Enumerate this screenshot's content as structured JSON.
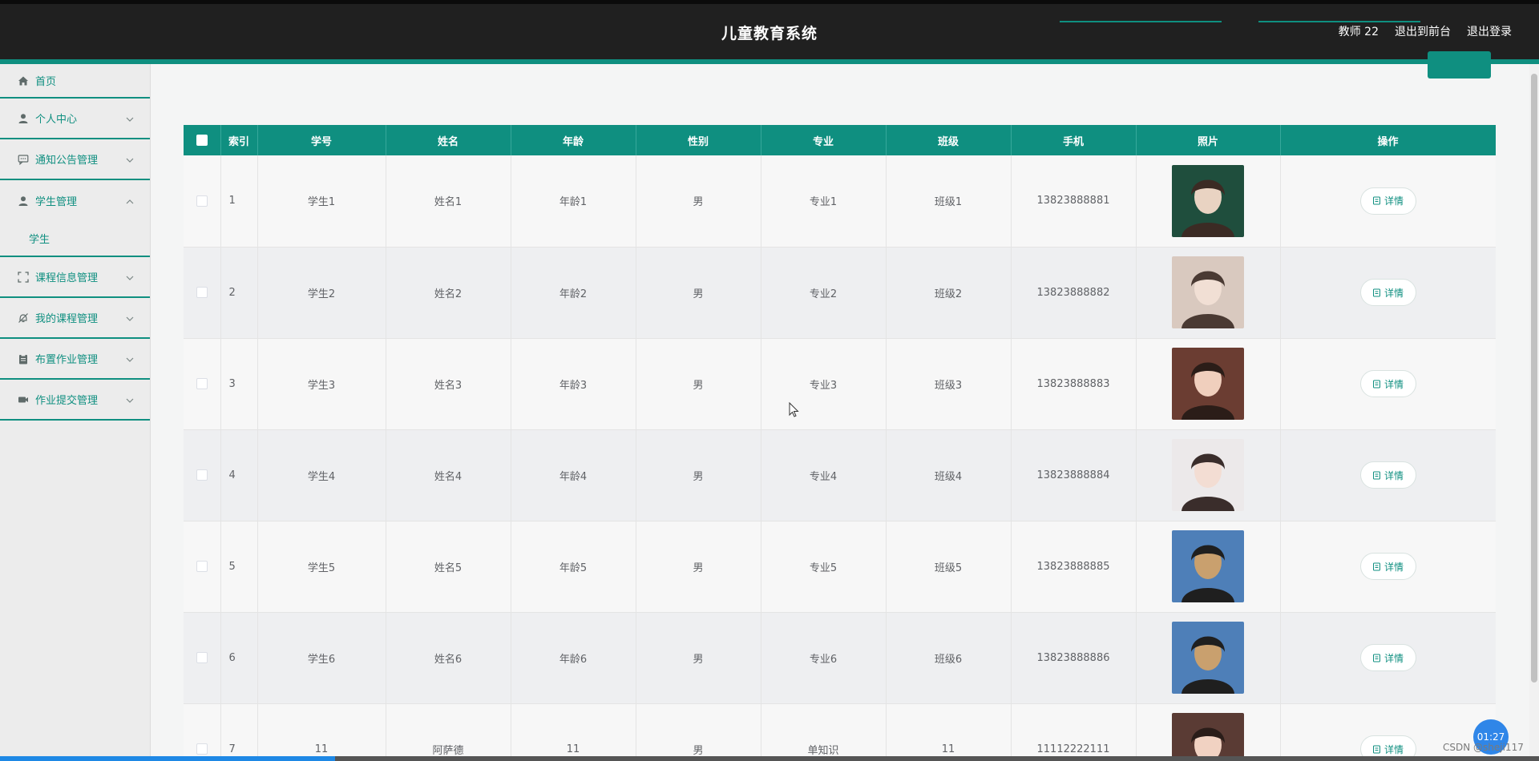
{
  "header": {
    "title": "儿童教育系统",
    "user": "教师 22",
    "front_link": "退出到前台",
    "logout": "退出登录"
  },
  "sidebar": {
    "items": [
      {
        "label": "首页",
        "icon": "home-icon"
      },
      {
        "label": "个人中心",
        "icon": "user-icon"
      },
      {
        "label": "通知公告管理",
        "icon": "message-icon"
      },
      {
        "label": "学生管理",
        "icon": "user-icon",
        "expanded": true,
        "sub": [
          "学生"
        ]
      },
      {
        "label": "课程信息管理",
        "icon": "fullscreen-icon"
      },
      {
        "label": "我的课程管理",
        "icon": "bell-off-icon"
      },
      {
        "label": "布置作业管理",
        "icon": "clipboard-icon"
      },
      {
        "label": "作业提交管理",
        "icon": "camera-icon"
      }
    ]
  },
  "table": {
    "columns": [
      "索引",
      "学号",
      "姓名",
      "年龄",
      "性别",
      "专业",
      "班级",
      "手机",
      "照片",
      "操作"
    ],
    "action_label": "详情",
    "rows": [
      {
        "idx": "1",
        "sid": "学生1",
        "name": "姓名1",
        "age": "年龄1",
        "sex": "男",
        "major": "专业1",
        "cls": "班级1",
        "phone": "13823888881"
      },
      {
        "idx": "2",
        "sid": "学生2",
        "name": "姓名2",
        "age": "年龄2",
        "sex": "男",
        "major": "专业2",
        "cls": "班级2",
        "phone": "13823888882"
      },
      {
        "idx": "3",
        "sid": "学生3",
        "name": "姓名3",
        "age": "年龄3",
        "sex": "男",
        "major": "专业3",
        "cls": "班级3",
        "phone": "13823888883"
      },
      {
        "idx": "4",
        "sid": "学生4",
        "name": "姓名4",
        "age": "年龄4",
        "sex": "男",
        "major": "专业4",
        "cls": "班级4",
        "phone": "13823888884"
      },
      {
        "idx": "5",
        "sid": "学生5",
        "name": "姓名5",
        "age": "年龄5",
        "sex": "男",
        "major": "专业5",
        "cls": "班级5",
        "phone": "13823888885"
      },
      {
        "idx": "6",
        "sid": "学生6",
        "name": "姓名6",
        "age": "年龄6",
        "sex": "男",
        "major": "专业6",
        "cls": "班级6",
        "phone": "13823888886"
      },
      {
        "idx": "7",
        "sid": "11",
        "name": "阿萨德",
        "age": "11",
        "sex": "男",
        "major": "单知识",
        "cls": "11",
        "phone": "11112222111"
      }
    ]
  },
  "overlay": {
    "timer": "01:27",
    "watermark": "CSDN @sheji117"
  },
  "colors": {
    "accent": "#0f8f80",
    "topbar": "#202020"
  }
}
